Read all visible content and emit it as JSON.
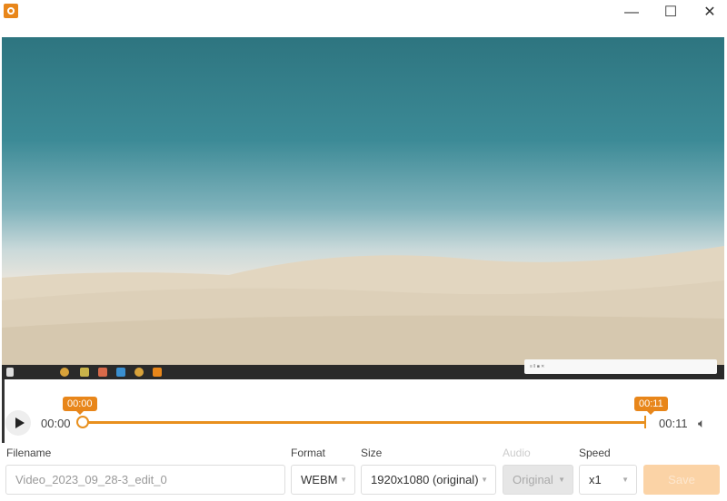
{
  "window": {
    "minimize": "—",
    "maximize": "☐",
    "close": "✕"
  },
  "player": {
    "start_tooltip": "00:00",
    "end_tooltip": "00:11",
    "current_time": "00:00",
    "duration": "00:11",
    "trim_start": 0,
    "trim_end": 1
  },
  "form": {
    "filename_label": "Filename",
    "filename_placeholder": "Video_2023_09_28-3_edit_0",
    "format_label": "Format",
    "format_value": "WEBM",
    "size_label": "Size",
    "size_value": "1920x1080 (original)",
    "audio_label": "Audio",
    "audio_value": "Original",
    "speed_label": "Speed",
    "speed_value": "x1",
    "save_label": "Save"
  },
  "colors": {
    "accent": "#e8861a"
  }
}
